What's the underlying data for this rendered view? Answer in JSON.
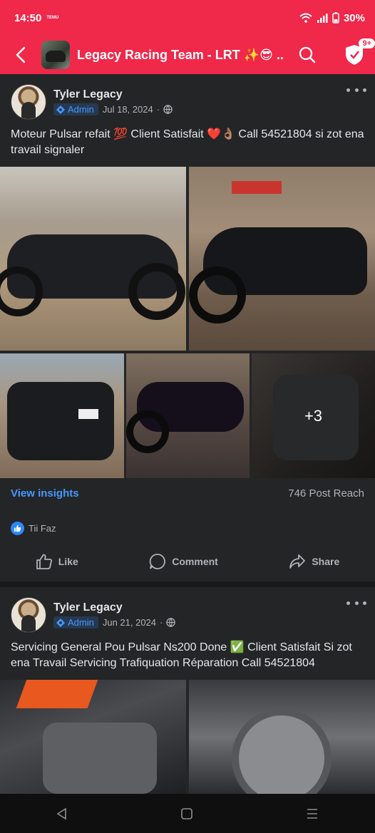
{
  "status_bar": {
    "time": "14:50",
    "carrier_badge": "TEMU",
    "battery": "30%"
  },
  "header": {
    "title": "Legacy Racing Team - LRT ✨😎 ...",
    "notification_count": "9+"
  },
  "posts": [
    {
      "author": "Tyler Legacy",
      "role": "Admin",
      "date": "Jul 18, 2024",
      "separator": "·",
      "text": "Moteur Pulsar refait 💯 Client Satisfait ❤️👌🏽 Call 54521804 si zot ena travail signaler",
      "more_photos": "+3",
      "insights_label": "View insights",
      "reach": "746 Post Reach",
      "reaction_name": "Tii Faz",
      "actions": {
        "like": "Like",
        "comment": "Comment",
        "share": "Share"
      }
    },
    {
      "author": "Tyler Legacy",
      "role": "Admin",
      "date": "Jun 21, 2024",
      "separator": "·",
      "text": "Servicing General Pou Pulsar Ns200 Done ✅ Client Satisfait Si zot ena Travail Servicing Trafiquation Réparation Call 54521804"
    }
  ],
  "colors": {
    "brand": "#f0284a",
    "card": "#242526",
    "link": "#4599ff"
  }
}
